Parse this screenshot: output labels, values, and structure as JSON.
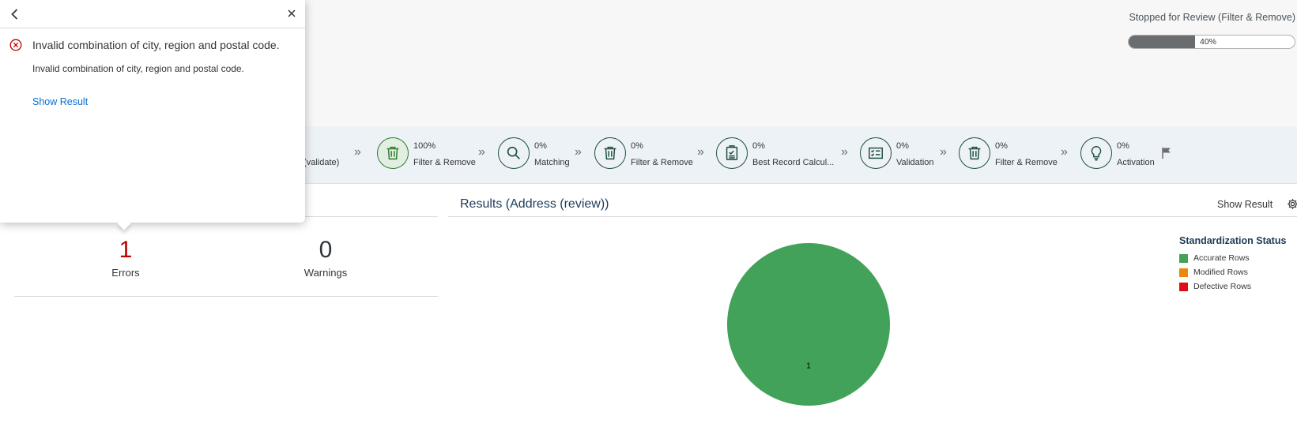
{
  "header": {
    "status_text": "Stopped for Review (Filter & Remove)",
    "progress_label": "40%",
    "progress_fraction": 0.4
  },
  "steps": {
    "partial_label": "ss (validate)",
    "items": [
      {
        "pct": "100%",
        "name": "Filter & Remove",
        "icon": "trash-icon",
        "done": true
      },
      {
        "pct": "0%",
        "name": "Matching",
        "icon": "search-icon",
        "done": false
      },
      {
        "pct": "0%",
        "name": "Filter & Remove",
        "icon": "trash-icon",
        "done": false
      },
      {
        "pct": "0%",
        "name": "Best Record Calcul...",
        "icon": "clipboard-icon",
        "done": false
      },
      {
        "pct": "0%",
        "name": "Validation",
        "icon": "checklist-icon",
        "done": false
      },
      {
        "pct": "0%",
        "name": "Filter & Remove",
        "icon": "trash-icon",
        "done": false
      },
      {
        "pct": "0%",
        "name": "Activation",
        "icon": "lightbulb-icon",
        "done": false
      }
    ]
  },
  "summary": {
    "errors_value": "1",
    "errors_label": "Errors",
    "warnings_value": "0",
    "warnings_label": "Warnings",
    "error_color": "#bb0000",
    "neutral_color": "#32363a"
  },
  "results": {
    "title": "Results (Address (review))",
    "show_result_label": "Show Result"
  },
  "chart_data": {
    "type": "pie",
    "categories": [
      "Accurate Rows",
      "Modified Rows",
      "Defective Rows"
    ],
    "values": [
      1,
      0,
      0
    ],
    "colors": [
      "#43a25a",
      "#e9890c",
      "#dd0e14"
    ],
    "data_labels": [
      "1",
      "",
      ""
    ],
    "legend_title": "Standardization Status",
    "legend_position": "top-right"
  },
  "popover": {
    "title": "Invalid combination of city, region and postal code.",
    "description": "Invalid combination of city, region and postal code.",
    "link_label": "Show Result"
  }
}
